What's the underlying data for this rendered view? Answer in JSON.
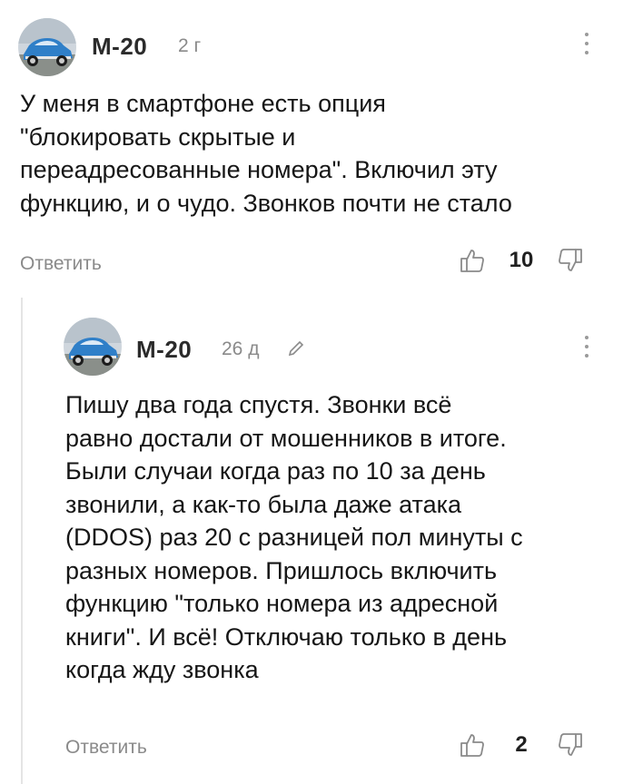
{
  "comments": [
    {
      "author": "М-20",
      "age": "2 г",
      "avatar_icon": "car-avatar-icon",
      "body_lines": [
        "У меня в смартфоне есть опция",
        "\"блокировать скрытые и",
        "переадресованные номера\". Включил эту",
        "функцию, и о чудо. Звонков почти не стало"
      ],
      "reply_label": "Ответить",
      "score": "10"
    },
    {
      "author": "М-20",
      "age": "26 д",
      "edited_icon": "pencil-icon",
      "avatar_icon": "car-avatar-icon",
      "body_lines": [
        "Пишу два года спустя. Звонки всё",
        "равно достали от мошенников в итоге.",
        "Были случаи когда раз по 10 за день",
        "звонили, а как-то была даже атака",
        "(DDOS) раз 20 с разницей пол минуты с",
        "разных номеров. Пришлось включить",
        "функцию \"только номера из адресной",
        "книги\". И всё! Отключаю только в день",
        "когда жду звонка"
      ],
      "reply_label": "Ответить",
      "score": "2"
    }
  ],
  "colors": {
    "text": "#161616",
    "muted": "#8a8a8a",
    "thread_line": "#e4e4e4",
    "car_blue": "#2f7fc8"
  }
}
